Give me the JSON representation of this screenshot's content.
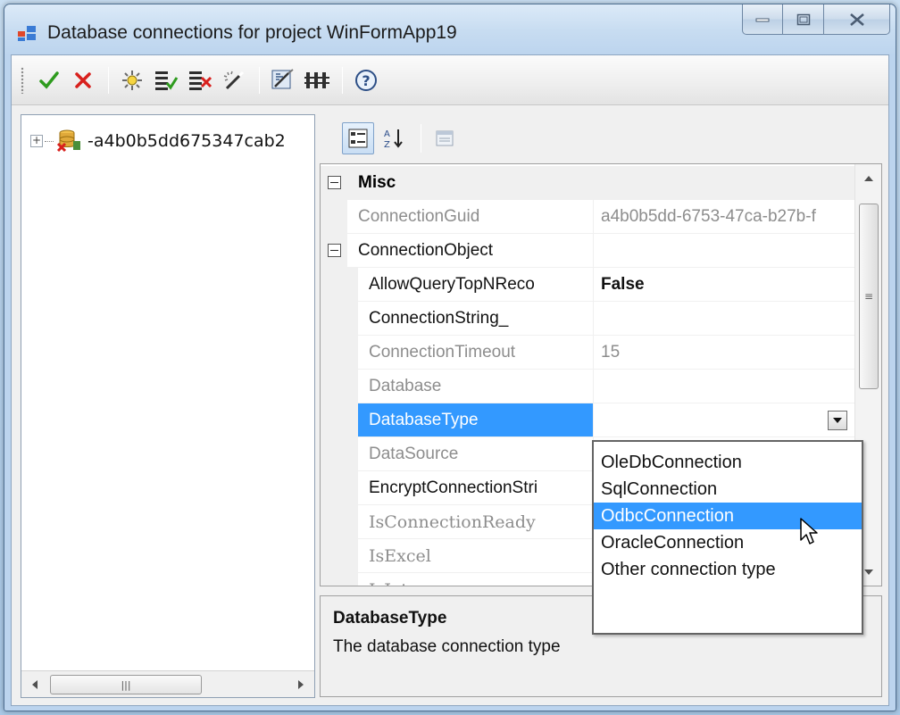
{
  "window": {
    "title": "Database connections for project WinFormApp19"
  },
  "toolbar": {
    "buttons": [
      {
        "icon": "checkmark-icon",
        "color": "#2e9b1e"
      },
      {
        "icon": "red-x-icon",
        "color": "#d8201d"
      },
      {
        "icon": "new-connection-icon"
      },
      {
        "icon": "accept-list-icon"
      },
      {
        "icon": "delete-list-icon"
      },
      {
        "icon": "wizard-wand-icon"
      },
      {
        "icon": "scan-icon"
      },
      {
        "icon": "compare-icon"
      },
      {
        "icon": "help-icon"
      }
    ]
  },
  "tree": {
    "node_label": "-a4b0b5dd675347cab2",
    "expander": "+"
  },
  "property_grid": {
    "category_misc": "Misc",
    "connection_guid": {
      "name": "ConnectionGuid",
      "value": "a4b0b5dd-6753-47ca-b27b-f"
    },
    "category_connection": "ConnectionObject",
    "allow_query": {
      "name": "AllowQueryTopNReco",
      "value": "False"
    },
    "connection_string": {
      "name": "ConnectionString_",
      "value": ""
    },
    "connection_timeout": {
      "name": "ConnectionTimeout",
      "value": "15"
    },
    "database": {
      "name": "Database",
      "value": ""
    },
    "database_type": {
      "name": "DatabaseType",
      "value": ""
    },
    "data_source": {
      "name": "DataSource"
    },
    "encrypt": {
      "name": "EncryptConnectionStri"
    },
    "is_connection_ready": {
      "name": "IsConnectionReady"
    },
    "is_excel": {
      "name": "IsExcel"
    },
    "is_jet": {
      "name": "IsJet"
    }
  },
  "dropdown": {
    "options": [
      "OleDbConnection",
      "SqlConnection",
      "OdbcConnection",
      "OracleConnection",
      "Other connection type"
    ],
    "highlighted": "OdbcConnection"
  },
  "description": {
    "title": "DatabaseType",
    "text": "The database connection type"
  },
  "colors": {
    "selection": "#3399ff",
    "readonly_text": "#8d8d8d"
  }
}
